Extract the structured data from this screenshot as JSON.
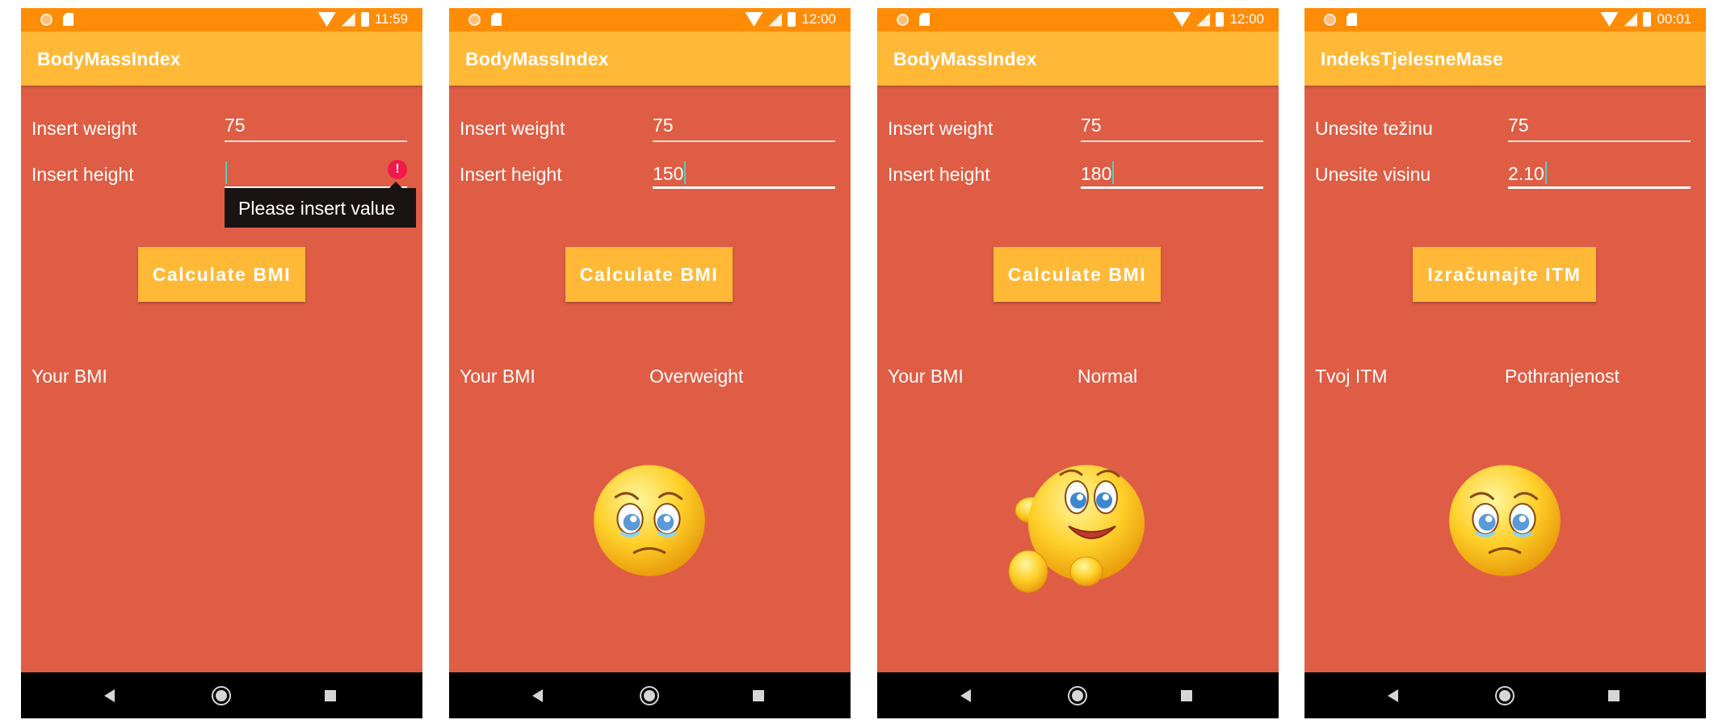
{
  "screens": [
    {
      "time": "11:59",
      "app_title": "BodyMassIndex",
      "weight_label": "Insert weight",
      "weight_value": "75",
      "height_label": "Insert height",
      "height_value": "",
      "error_tooltip": "Please insert value",
      "button_label": "Calculate BMI",
      "result_label": "Your BMI",
      "result_value": "",
      "emoji": "none"
    },
    {
      "time": "12:00",
      "app_title": "BodyMassIndex",
      "weight_label": "Insert weight",
      "weight_value": "75",
      "height_label": "Insert height",
      "height_value": "150",
      "button_label": "Calculate BMI",
      "result_label": "Your BMI",
      "result_value": "Overweight",
      "emoji": "sad-face"
    },
    {
      "time": "12:00",
      "app_title": "BodyMassIndex",
      "weight_label": "Insert weight",
      "weight_value": "75",
      "height_label": "Insert height",
      "height_value": "180",
      "button_label": "Calculate BMI",
      "result_label": "Your BMI",
      "result_value": "Normal",
      "emoji": "happy-face"
    },
    {
      "time": "00:01",
      "app_title": "IndeksTjelesneMase",
      "weight_label": "Unesite težinu",
      "weight_value": "75",
      "height_label": "Unesite visinu",
      "height_value": "2.10",
      "button_label": "Izračunajte ITM",
      "result_label": "Tvoj ITM",
      "result_value": "Pothranjenost",
      "emoji": "sad-face"
    }
  ],
  "colors": {
    "status_bar": "#ff8c07",
    "app_bar": "#ffb937",
    "background": "#df5d44",
    "button": "#ffb937",
    "nav_bar": "#000000",
    "error": "#f0194a"
  }
}
